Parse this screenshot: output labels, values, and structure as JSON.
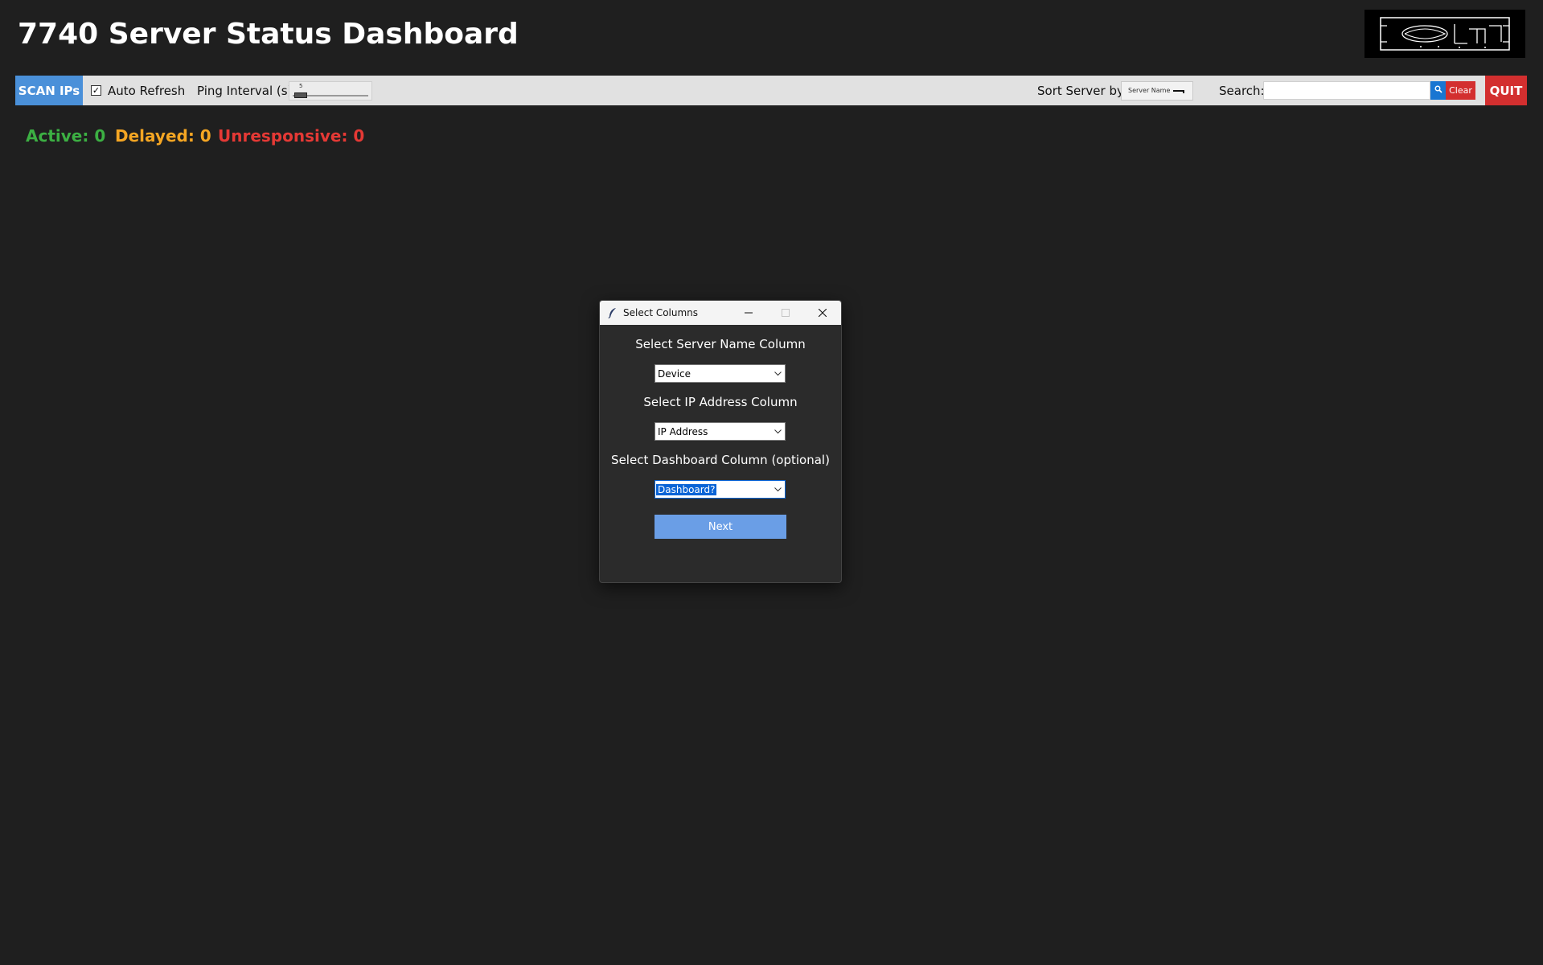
{
  "header": {
    "title": "7740 Server Status Dashboard",
    "logo_icon": "logo-image"
  },
  "toolbar": {
    "scan_label": "SCAN IPs",
    "auto_refresh": {
      "label": "Auto Refresh",
      "checked": true
    },
    "ping_interval": {
      "label": "Ping Interval (s):",
      "value": "5"
    },
    "sort": {
      "label": "Sort Server by:",
      "selected": "Server Name"
    },
    "search": {
      "label": "Search:",
      "value": "",
      "placeholder": "",
      "button_icon": "search-icon"
    },
    "clear_label": "Clear",
    "quit_label": "QUIT"
  },
  "status": {
    "active": "Active: 0",
    "delayed": "Delayed: 0",
    "unresponsive": "Unresponsive: 0"
  },
  "dialog": {
    "title": "Select Columns",
    "server_name": {
      "label": "Select Server Name Column",
      "selected": "Device"
    },
    "ip_address": {
      "label": "Select IP Address Column",
      "selected": "IP Address"
    },
    "dashboard": {
      "label": "Select Dashboard Column (optional)",
      "selected": "Dashboard?"
    },
    "next_label": "Next"
  },
  "colors": {
    "background": "#1f1f1f",
    "toolbar": "#e1e1e1",
    "scan_button": "#4a90d9",
    "danger": "#d32f2f",
    "search_button": "#1976d2",
    "active": "#3cb043",
    "delayed": "#f5a623",
    "unresponsive": "#e53935",
    "dialog_body": "#2b2b2b",
    "next_button": "#6a9ee6"
  }
}
